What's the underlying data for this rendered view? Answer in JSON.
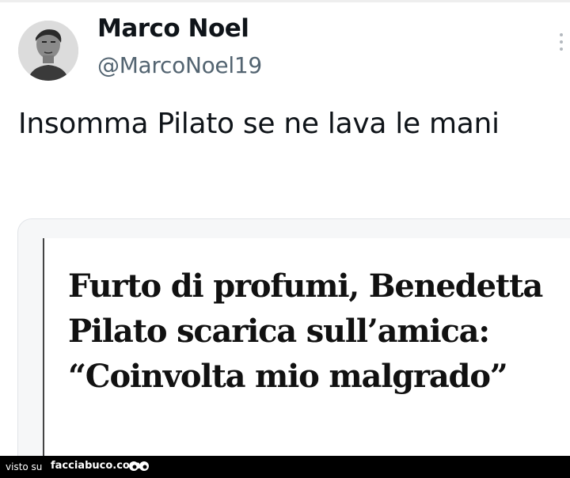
{
  "tweet": {
    "display_name": "Marco Noel",
    "handle": "@MarcoNoel19",
    "text": "Insomma Pilato se ne lava le mani",
    "avatar_icon": "user-avatar",
    "more_icon": "more-vertical-icon"
  },
  "card": {
    "headline": "Furto di profumi, Benedetta Pilato scarica sull’amica: “Coinvolta mio malgrado”"
  },
  "footer": {
    "visto_label": "visto su",
    "site_label": "facciabuco.com",
    "logo_icon": "eyes-icon"
  },
  "colors": {
    "text_primary": "#0f1419",
    "text_secondary": "#536471",
    "card_border": "#e1e4e8",
    "footer_bg": "#000000"
  }
}
